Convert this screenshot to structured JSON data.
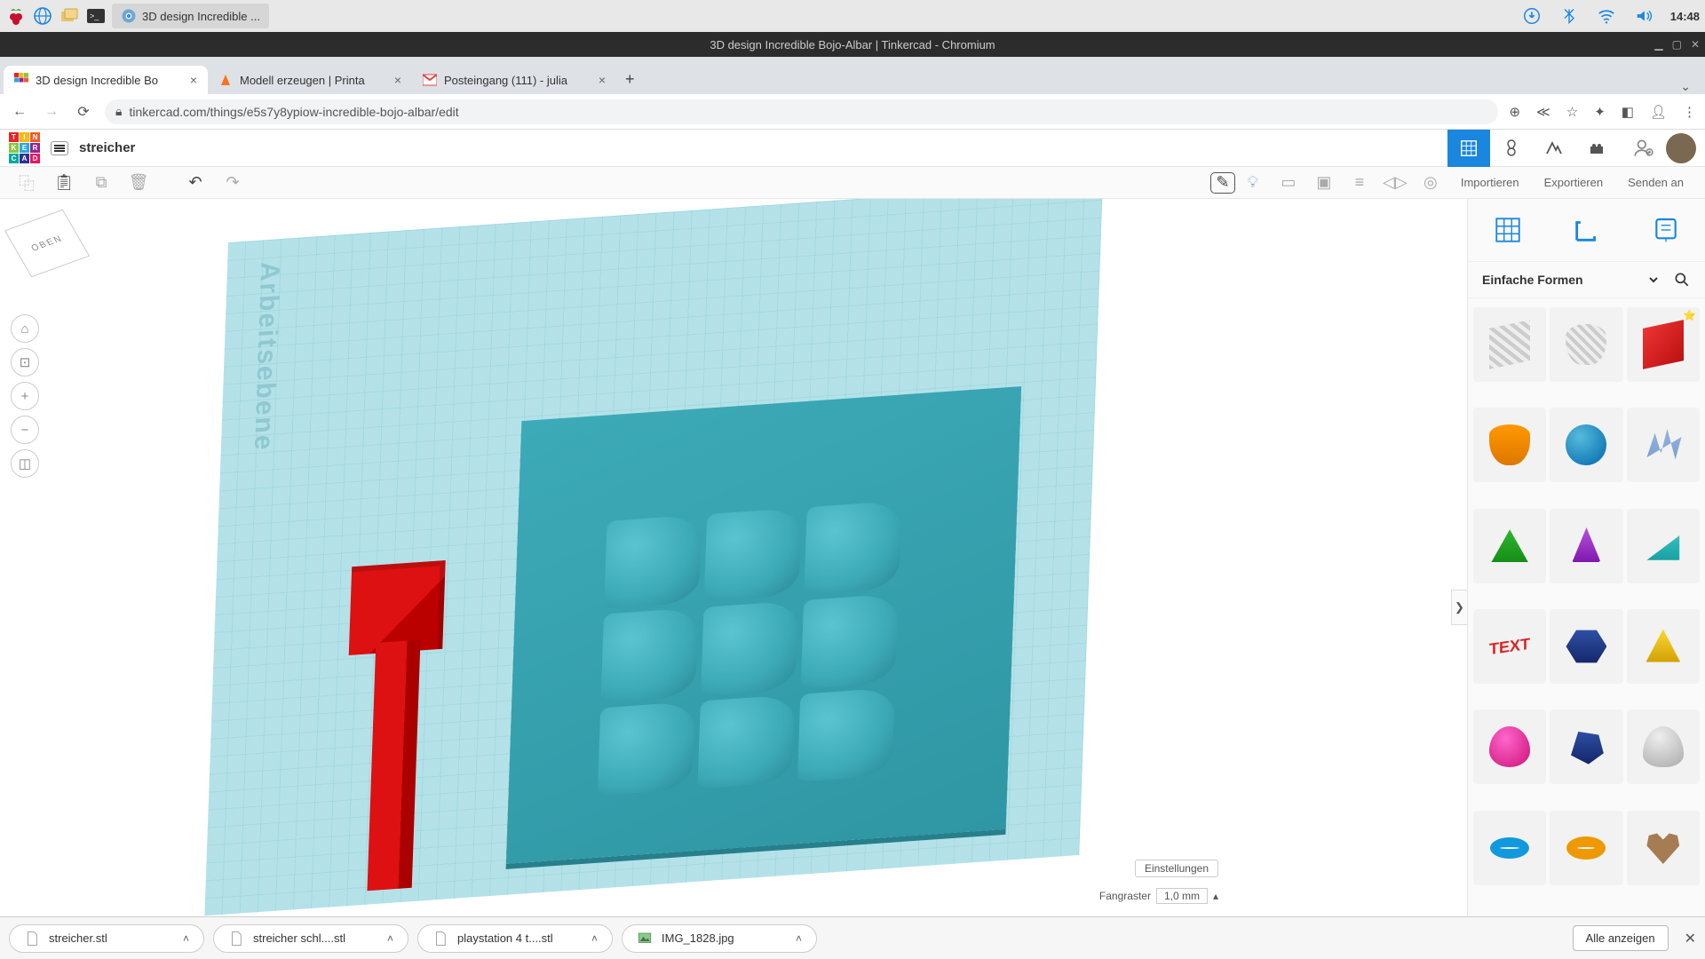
{
  "os": {
    "clock": "14:48",
    "app_title": "3D design Incredible ..."
  },
  "chrome": {
    "window_title": "3D design Incredible Bojo-Albar | Tinkercad - Chromium",
    "tabs": [
      {
        "label": "3D design Incredible Bo"
      },
      {
        "label": "Modell erzeugen | Printa"
      },
      {
        "label": "Posteingang (111) - julia"
      }
    ],
    "url": "tinkercad.com/things/e5s7y8ypiow-incredible-bojo-albar/edit"
  },
  "tc": {
    "project": "streicher",
    "actions": {
      "import": "Importieren",
      "export": "Exportieren",
      "sendto": "Senden an"
    }
  },
  "panel": {
    "category": "Einfache Formen"
  },
  "canvas": {
    "workplane_label": "Arbeitsebene",
    "view_cube": "OBEN",
    "settings": "Einstellungen",
    "snap_label": "Fangraster",
    "snap_value": "1,0 mm"
  },
  "downloads": {
    "items": [
      {
        "name": "streicher.stl"
      },
      {
        "name": "streicher schl....stl"
      },
      {
        "name": "playstation 4 t....stl"
      },
      {
        "name": "IMG_1828.jpg"
      }
    ],
    "show_all": "Alle anzeigen"
  }
}
